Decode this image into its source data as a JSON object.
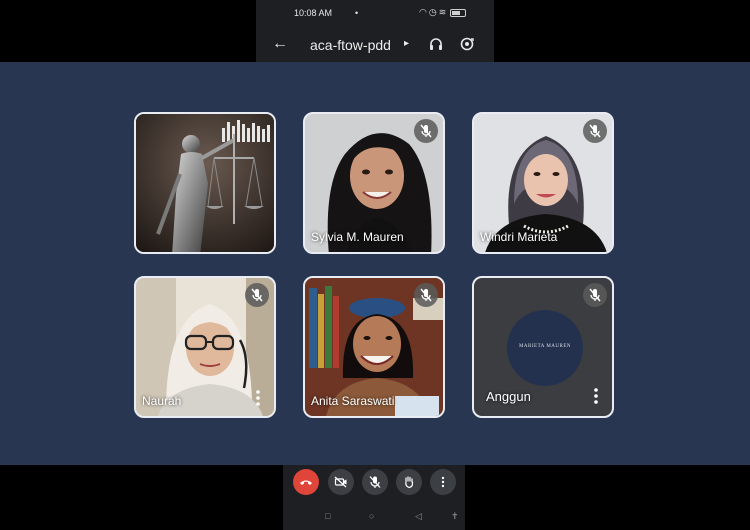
{
  "status_bar": {
    "time": "10:08 AM",
    "dot": "•"
  },
  "header": {
    "meeting_code": "aca-ftow-pdd",
    "chevron": "▸"
  },
  "participants": [
    {
      "name": "",
      "muted": false,
      "photo": "lady-justice-statue"
    },
    {
      "name": "Sylvia M. Mauren",
      "muted": true,
      "photo": "woman-portrait"
    },
    {
      "name": "Windri Marieta",
      "muted": true,
      "photo": "woman-hijab-portrait"
    },
    {
      "name": "Naurah",
      "muted": true,
      "photo": "woman-hijab-glasses"
    },
    {
      "name": "Anita Saraswati",
      "muted": true,
      "photo": "woman-smiling-books"
    },
    {
      "name": "Anggun",
      "muted": true,
      "photo": "avatar-logo",
      "avatar_text": "MARIETA MAUREN"
    }
  ],
  "controls": [
    "end-call",
    "camera-off",
    "mic-off",
    "raise-hand",
    "more-options"
  ],
  "colors": {
    "stage": "#283651",
    "end_call": "#e0453a",
    "tile_border": "#e9edf3"
  }
}
